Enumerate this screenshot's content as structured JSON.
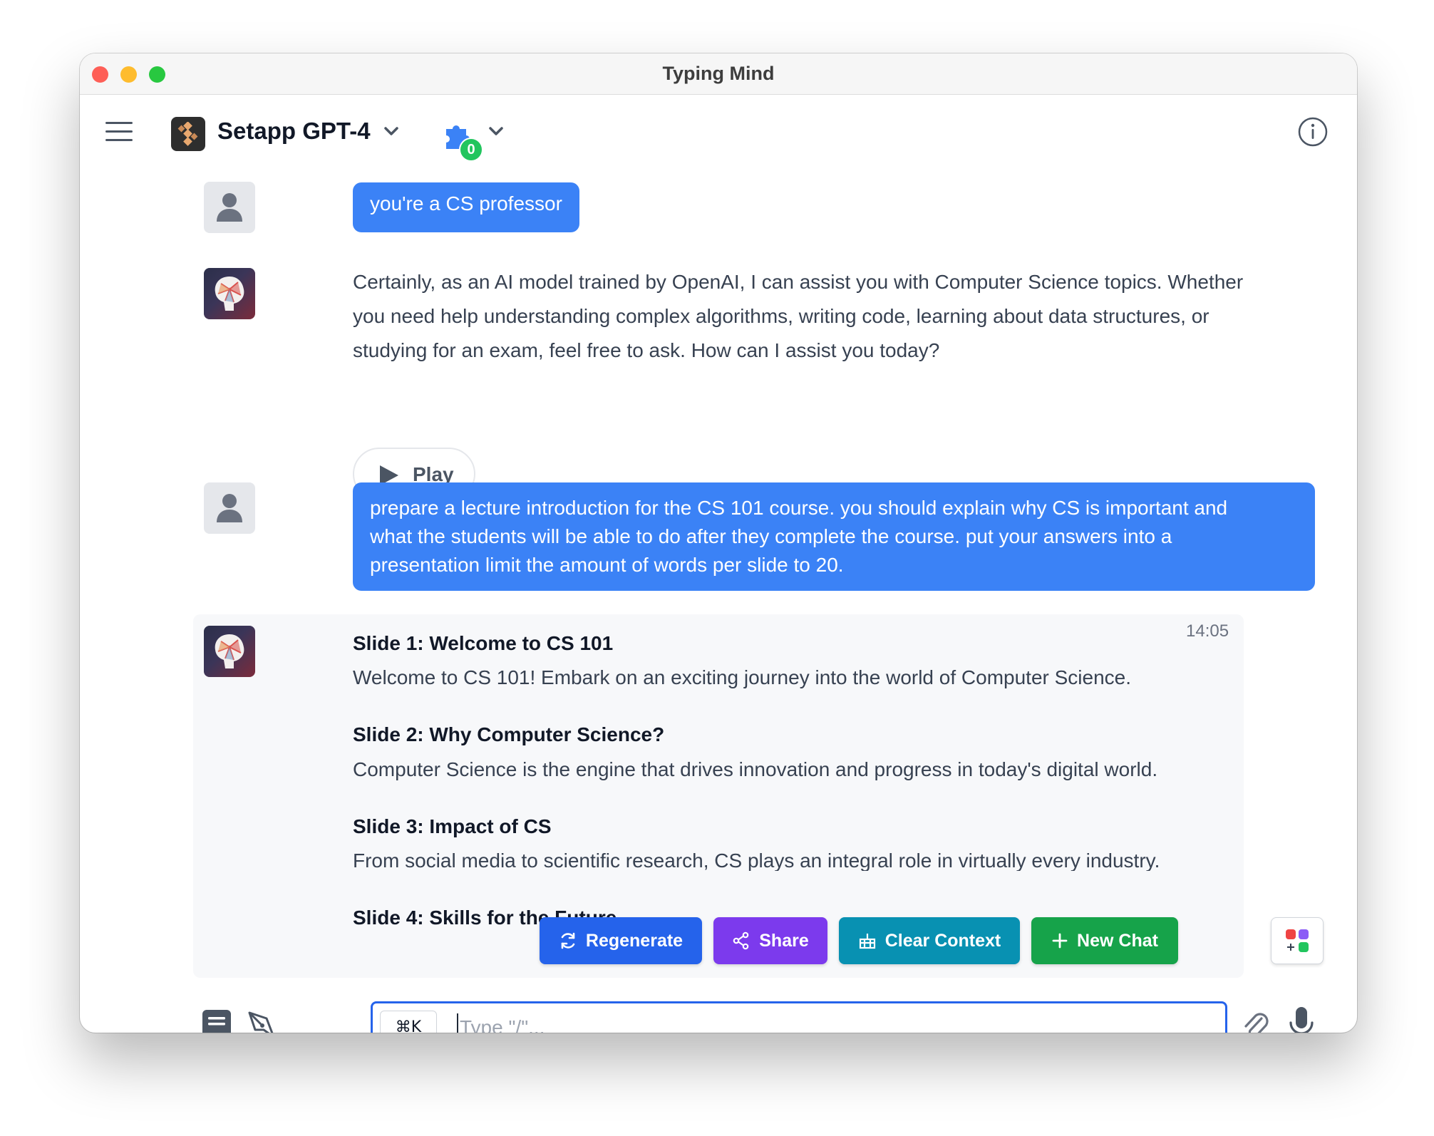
{
  "window": {
    "title": "Typing Mind"
  },
  "header": {
    "model_name": "Setapp GPT-4",
    "plugin_count": "0"
  },
  "messages": [
    {
      "role": "user",
      "text": "you're a CS professor"
    },
    {
      "role": "assistant",
      "lines": [
        "Certainly, as an AI model trained by OpenAI, I can assist you with Computer Science topics. Whether",
        "you need help understanding complex algorithms, writing code, learning about data structures, or",
        "studying for an exam, feel free to ask. How can I assist you today?"
      ],
      "play_label": "Play"
    },
    {
      "role": "user",
      "lines": [
        "prepare a lecture introduction for the CS 101 course. you should explain why CS is important and",
        "what the students will be able to do after they complete the course. put your answers into a",
        "presentation limit the amount of words per slide to 20."
      ]
    },
    {
      "role": "assistant",
      "timestamp": "14:05",
      "slides": [
        {
          "title": "Slide 1: Welcome to CS 101",
          "body": "Welcome to CS 101! Embark on an exciting journey into the world of Computer Science."
        },
        {
          "title": "Slide 2: Why Computer Science?",
          "body": "Computer Science is the engine that drives innovation and progress in today's digital world."
        },
        {
          "title": "Slide 3: Impact of CS",
          "body": "From social media to scientific research, CS plays an integral role in virtually every industry."
        },
        {
          "title": "Slide 4: Skills for the Future",
          "body": ""
        }
      ]
    }
  ],
  "actions": {
    "regenerate": "Regenerate",
    "share": "Share",
    "clear_context": "Clear Context",
    "new_chat": "New Chat"
  },
  "colors": {
    "regenerate": "#2563eb",
    "share": "#7c3aed",
    "clear_context": "#0891b2",
    "new_chat": "#16a34a",
    "user_bubble": "#3b82f6",
    "input_border": "#2563eb"
  },
  "input": {
    "shortcut": "⌘K",
    "placeholder": "Type \"/\"..."
  },
  "icons": [
    "menu-icon",
    "model-logo-icon",
    "chevron-down-icon",
    "puzzle-icon",
    "info-icon",
    "user-icon",
    "ai-brain-icon",
    "play-icon",
    "refresh-icon",
    "share-icon",
    "broom-icon",
    "plus-icon",
    "apps-icon",
    "book-icon",
    "pen-icon",
    "paperclip-icon",
    "microphone-icon"
  ]
}
